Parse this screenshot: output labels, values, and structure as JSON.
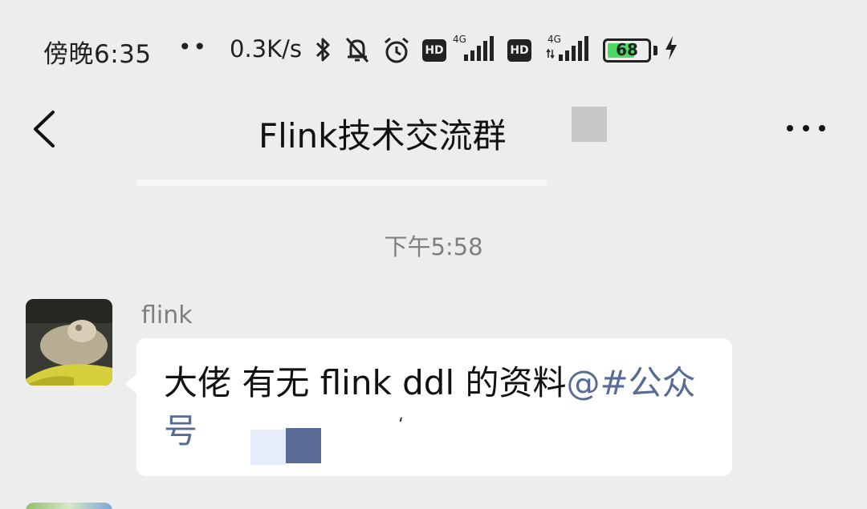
{
  "status_bar": {
    "time": "傍晚6:35",
    "dots": "••",
    "net_speed": "0.3K/s",
    "sim1_label": "4G",
    "sim2_label": "4G",
    "hd_label": "HD",
    "battery_level": "68",
    "battery_fraction": 0.68,
    "icons": [
      "bluetooth-icon",
      "mute-bell-icon",
      "alarm-icon",
      "hd-icon",
      "signal-icon",
      "hd-icon",
      "signal-icon",
      "battery-icon",
      "charging-icon"
    ]
  },
  "nav": {
    "title": "Flink技术交流群",
    "back_icon": "chevron-left-icon",
    "more_icon": "more-dots-icon"
  },
  "chat": {
    "timestamp": "下午5:58",
    "messages": [
      {
        "sender": "flink",
        "text": "大佬  有无 flink  ddl 的资料",
        "mention": "@#公众号"
      }
    ]
  },
  "colors": {
    "background": "#ededed",
    "bubble": "#ffffff",
    "mention": "#576b95",
    "battery": "#4cd964"
  }
}
